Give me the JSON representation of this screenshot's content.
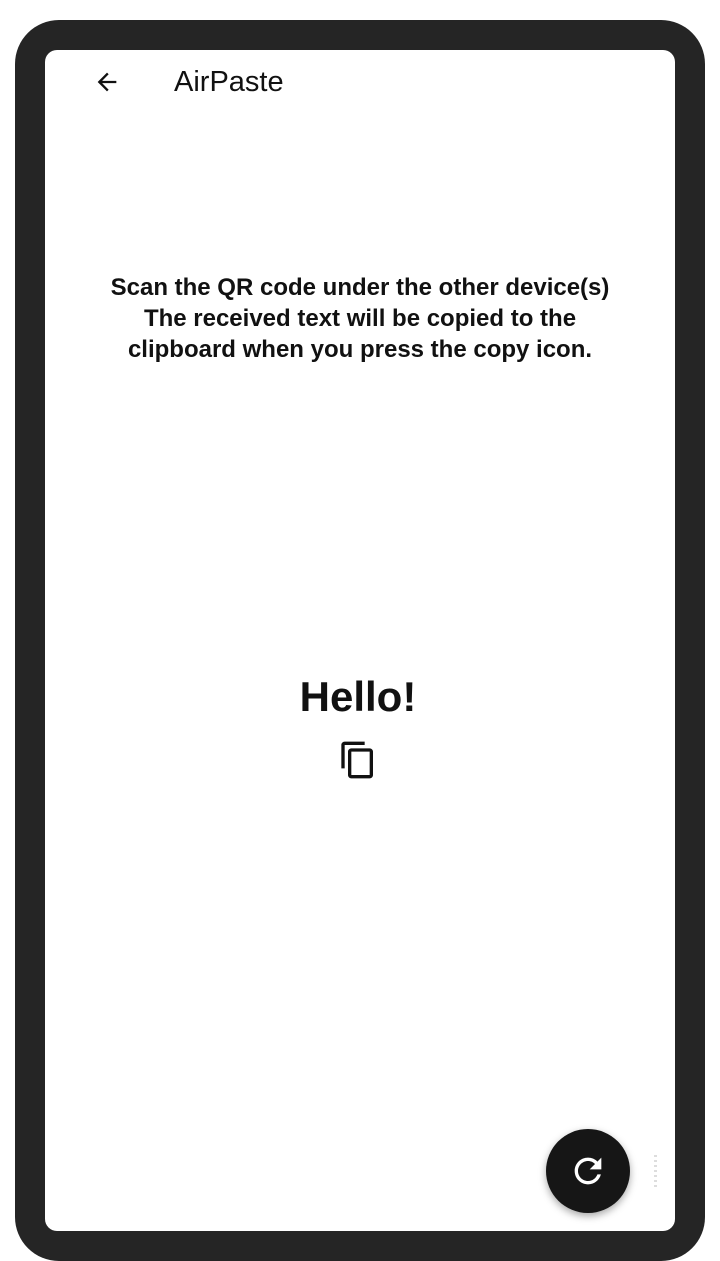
{
  "app_bar": {
    "back_icon": "arrow-back-icon",
    "title": "AirPaste"
  },
  "instructions": {
    "lines": [
      "Scan the QR code under the other device(s)",
      "The received text will be copied to the",
      "clipboard when you press the copy icon."
    ]
  },
  "received": {
    "text": "Hello!",
    "copy_icon": "content-copy-icon"
  },
  "fab": {
    "icon": "refresh-icon"
  },
  "colors": {
    "frame": "#252525",
    "screen_background": "#ffffff",
    "text": "#111111",
    "fab_background": "#161616",
    "fab_icon": "#ffffff"
  }
}
